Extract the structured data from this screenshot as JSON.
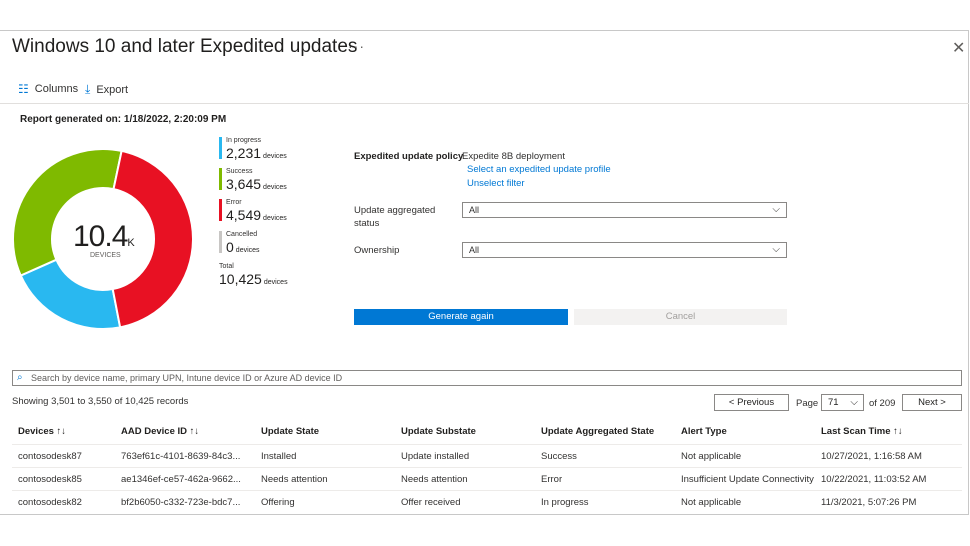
{
  "header": {
    "title": "Windows 10 and later Expedited updates",
    "more": "···",
    "close": "✕"
  },
  "toolbar": {
    "columns_label": "Columns",
    "export_label": "Export"
  },
  "report": {
    "generated": "Report generated on: 1/18/2022, 2:20:09 PM"
  },
  "chart_data": {
    "type": "pie",
    "center_value": "10.4",
    "center_suffix": "K",
    "center_label": "DEVICES",
    "slices": [
      {
        "name": "In progress",
        "value": 2231,
        "color": "#29b8f0"
      },
      {
        "name": "Success",
        "value": 3645,
        "color": "#7fba00"
      },
      {
        "name": "Error",
        "value": 4549,
        "color": "#e81123"
      },
      {
        "name": "Cancelled",
        "value": 0,
        "color": "#a19f9d"
      }
    ]
  },
  "legend": {
    "unit": "devices",
    "items": [
      {
        "label": "In progress",
        "value": "2,231",
        "color": "#29b8f0"
      },
      {
        "label": "Success",
        "value": "3,645",
        "color": "#7fba00"
      },
      {
        "label": "Error",
        "value": "4,549",
        "color": "#e81123"
      },
      {
        "label": "Cancelled",
        "value": "0",
        "color": "#c8c6c4"
      }
    ],
    "total_label": "Total",
    "total_value": "10,425"
  },
  "filters": {
    "policy_label": "Expedited update policy",
    "policy_value": "Expedite 8B deployment",
    "select_profile_link": "Select an expedited update profile",
    "unselect_link": "Unselect filter",
    "aggregated_label_1": "Update aggregated",
    "aggregated_label_2": "status",
    "aggregated_value": "All",
    "ownership_label": "Ownership",
    "ownership_value": "All",
    "generate_label": "Generate again",
    "cancel_label": "Cancel"
  },
  "search": {
    "placeholder": "Search by device name, primary UPN, Intune device ID or Azure AD device ID"
  },
  "pagination": {
    "showing": "Showing 3,501 to 3,550 of 10,425 records",
    "previous": "< Previous",
    "page_label": "Page",
    "page_value": "71",
    "of_label": "of 209",
    "next": "Next >"
  },
  "table": {
    "columns": [
      "Devices ↑↓",
      "AAD Device ID ↑↓",
      "Update State",
      "Update Substate",
      "Update Aggregated State",
      "Alert Type",
      "Last Scan Time ↑↓"
    ],
    "rows": [
      [
        "contosodesk87",
        "763ef61c-4101-8639-84c3...",
        "Installed",
        "Update installed",
        "Success",
        "Not applicable",
        "10/27/2021, 1:16:58 AM"
      ],
      [
        "contosodesk85",
        "ae1346ef-ce57-462a-9662...",
        "Needs attention",
        "Needs attention",
        "Error",
        "Insufficient Update Connectivity",
        "10/22/2021, 11:03:52 AM"
      ],
      [
        "contosodesk82",
        "bf2b6050-c332-723e-bdc7...",
        "Offering",
        "Offer received",
        "In progress",
        "Not applicable",
        "11/3/2021, 5:07:26 PM"
      ]
    ]
  }
}
